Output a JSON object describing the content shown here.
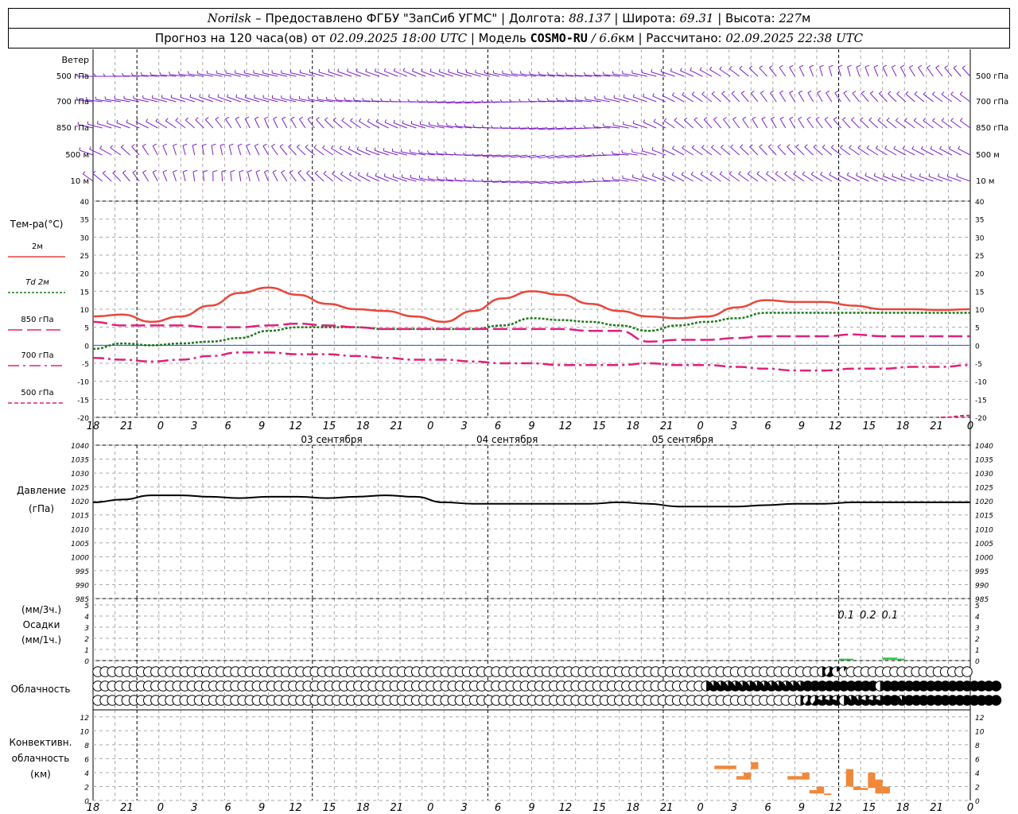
{
  "header": {
    "line1": {
      "station": "Norilsk",
      "dash": " – ",
      "provider": "Предоставлено ФГБУ \"ЗапСиб УГМС\"",
      "sep": " | ",
      "lon_label": "Долгота: ",
      "lon": "88.137",
      "lat_label": "Широта: ",
      "lat": "69.31",
      "alt_label": "Высота: ",
      "alt": "227",
      "alt_unit": "м"
    },
    "line2": {
      "prefix": "Прогноз на 120 часа(ов) от ",
      "start": "02.09.2025 18:00 UTC",
      "model_label": "  | Модель ",
      "model": "COSMO-RU",
      "model_res_sep": " / ",
      "model_res": "6.6",
      "model_res_unit": "км",
      "calc_label": " | Рассчитано: ",
      "calc": "02.09.2025 22:38 UTC"
    }
  },
  "labels": {
    "wind_title": "Ветер",
    "wind_levels": [
      "500 гПа",
      "700 гПа",
      "850 гПа",
      "500 м",
      "10  м"
    ],
    "temp_title": "Тем-ра(°C)",
    "temp_legend": [
      "2м",
      "Td  2м",
      "850 гПа",
      "700 гПа",
      "500 гПа"
    ],
    "pressure_title": "Давление",
    "pressure_unit": "(гПа)",
    "precip_unit_top": "(мм/3ч.)",
    "precip_title": "Осадки",
    "precip_unit_bottom": "(мм/1ч.)",
    "cloud_title": "Облачность",
    "conv_title": [
      "Конвективн.",
      "облачность",
      "(км)"
    ]
  },
  "colors": {
    "t2m": "#e8463c",
    "td2m": "#1a7a1a",
    "t850": "#e0207a",
    "t700": "#e0207a",
    "t500": "#e0207a",
    "wind": "#7b22c8",
    "pressure": "#000000",
    "precip": "#2ecc40",
    "conv": "#f0883a",
    "grid": "#aaaaaa"
  },
  "chart_data": [
    {
      "type": "line",
      "panel": "temperature",
      "x_hours": [
        0,
        3,
        6,
        9,
        12,
        15,
        18,
        21,
        24,
        27,
        30,
        33,
        36,
        39,
        42,
        45,
        48,
        51,
        54,
        57,
        60,
        63,
        66,
        69,
        72,
        75,
        78,
        81,
        84,
        87,
        90,
        93,
        96,
        99,
        102,
        105,
        108,
        111,
        114,
        117,
        120
      ],
      "x_tick_labels": [
        "18",
        "21",
        "0",
        "3",
        "6",
        "9",
        "12",
        "15",
        "18",
        "21",
        "0",
        "3",
        "6",
        "9",
        "12",
        "15",
        "18",
        "21",
        "0",
        "3",
        "6",
        "9",
        "12",
        "15",
        "18",
        "21",
        "0"
      ],
      "date_labels": [
        "03 сентября",
        "04 сентября",
        "05 сентября"
      ],
      "ylim": [
        -20,
        40
      ],
      "yticks": [
        -20,
        -15,
        -10,
        -5,
        0,
        5,
        10,
        15,
        20,
        25,
        30,
        35,
        40
      ],
      "series": [
        {
          "name": "2м",
          "style": "solid",
          "values": [
            8,
            8.5,
            6.5,
            8,
            11,
            14.5,
            16,
            14,
            11.5,
            10,
            9.5,
            8,
            6.5,
            9.5,
            13,
            15,
            14,
            11.5,
            9.5,
            8,
            7.5,
            8,
            10.5,
            12.5,
            12,
            12,
            11,
            10,
            10,
            9.8,
            10
          ]
        },
        {
          "name": "Td  2м",
          "style": "dotted",
          "values": [
            -1,
            0.5,
            0,
            0.5,
            1,
            2,
            4,
            5,
            5,
            5,
            4.5,
            4.5,
            4.5,
            4.5,
            5.5,
            7.5,
            7,
            6.5,
            5.5,
            4,
            5.5,
            6.5,
            7.5,
            9,
            9,
            9,
            9,
            9,
            9,
            9,
            9
          ]
        },
        {
          "name": "850 гПа",
          "style": "longdash",
          "values": [
            6.5,
            5.5,
            5.5,
            5.5,
            5,
            5,
            5.5,
            6,
            5.5,
            5,
            4.5,
            4.5,
            4.5,
            4.5,
            4.5,
            4.5,
            4.5,
            4,
            4,
            1,
            1.5,
            1.5,
            2,
            2.5,
            2.5,
            2.5,
            3,
            2.5,
            2.5,
            2.5,
            2.5
          ]
        },
        {
          "name": "700 гПа",
          "style": "dashdot",
          "values": [
            -3.5,
            -4,
            -4.5,
            -4,
            -3,
            -2,
            -2,
            -2.5,
            -2.5,
            -3,
            -3.5,
            -4,
            -4,
            -4.5,
            -5,
            -5,
            -5.5,
            -5.5,
            -5.5,
            -5,
            -5.5,
            -5.5,
            -6,
            -6.5,
            -7,
            -7,
            -6.5,
            -6.5,
            -6,
            -6,
            -5.5
          ]
        },
        {
          "name": "500 гПа",
          "style": "shortdash",
          "values": [
            -20,
            -20,
            -20,
            -20,
            -20,
            -20,
            -20,
            -20,
            -20,
            -20,
            -20,
            -20,
            -20,
            -20,
            -20,
            -20,
            -20,
            -20,
            -20,
            -20,
            -20,
            -20,
            -20,
            -20,
            -20,
            -20,
            -20,
            -20,
            -20,
            -20,
            -19.5
          ]
        }
      ]
    },
    {
      "type": "line",
      "panel": "pressure",
      "ylim": [
        985,
        1040
      ],
      "yticks": [
        985,
        990,
        995,
        1000,
        1005,
        1010,
        1015,
        1020,
        1025,
        1030,
        1035,
        1040
      ],
      "series": [
        {
          "name": "",
          "values": [
            1019.5,
            1020.5,
            1022,
            1022,
            1021.5,
            1021,
            1021.5,
            1021.5,
            1021,
            1021.5,
            1022,
            1021.5,
            1019.5,
            1019,
            1019,
            1019,
            1019,
            1019,
            1019.5,
            1019,
            1018,
            1018,
            1018,
            1018.5,
            1019,
            1019,
            1019.5,
            1019.5,
            1019.5,
            1019.5,
            1019.5
          ]
        }
      ]
    },
    {
      "type": "bar",
      "panel": "precipitation",
      "ylim": [
        0,
        5
      ],
      "yticks": [
        0,
        1,
        2,
        3,
        4,
        5
      ],
      "annotations": [
        {
          "x_hour": 103,
          "text": "0.1"
        },
        {
          "x_hour": 106,
          "text": "0.2"
        },
        {
          "x_hour": 109,
          "text": "0.1"
        }
      ],
      "bars": [
        {
          "x_hour": 102,
          "dx": 2,
          "value": 0.1
        },
        {
          "x_hour": 108,
          "dx": 1,
          "value": 0.2
        },
        {
          "x_hour": 109,
          "dx": 1,
          "value": 0.2
        },
        {
          "x_hour": 110,
          "dx": 1,
          "value": 0.1
        }
      ]
    },
    {
      "type": "table",
      "panel": "cloudiness",
      "rows": [
        "upper",
        "middle",
        "low"
      ],
      "fractions": [
        [
          0,
          0,
          0,
          0,
          0,
          0,
          0,
          0,
          0,
          0,
          0,
          0,
          0,
          0,
          0,
          0,
          0,
          0,
          0,
          0,
          0,
          0,
          0,
          0,
          0,
          0,
          0,
          0,
          0,
          0,
          0,
          0,
          0,
          0,
          0,
          0,
          0,
          0,
          0,
          0,
          0,
          0,
          0,
          0,
          0,
          0,
          0,
          0,
          0,
          0,
          0,
          0,
          0,
          0,
          0,
          0,
          0,
          0,
          0,
          0,
          0,
          0,
          0,
          0,
          0,
          0,
          0,
          0,
          0,
          0,
          0,
          0,
          0,
          0,
          0,
          0,
          0,
          0,
          0,
          0,
          0,
          0,
          0,
          0,
          0,
          0,
          0,
          0,
          0,
          0,
          0,
          0,
          0,
          0,
          0,
          0,
          0,
          0,
          0,
          0,
          0.5,
          0.6,
          0.2,
          0.1,
          0,
          0,
          0,
          0,
          0,
          0,
          0,
          0,
          0,
          0,
          0,
          0,
          0,
          0,
          0,
          0,
          0
        ],
        [
          0,
          0,
          0,
          0,
          0,
          0,
          0,
          0,
          0,
          0,
          0,
          0,
          0,
          0,
          0,
          0,
          0,
          0,
          0,
          0,
          0,
          0,
          0,
          0,
          0,
          0,
          0,
          0,
          0,
          0,
          0,
          0,
          0,
          0,
          0,
          0,
          0,
          0,
          0,
          0,
          0,
          0,
          0,
          0,
          0,
          0,
          0,
          0,
          0,
          0,
          0,
          0,
          0,
          0,
          0,
          0,
          0,
          0,
          0,
          0,
          0,
          0,
          0,
          0,
          0,
          0,
          0,
          0,
          0,
          0,
          0,
          0,
          0,
          0,
          0,
          0,
          0,
          0,
          0,
          0,
          0,
          0,
          0,
          0,
          0.5,
          0.9,
          0.9,
          0.9,
          0.9,
          0.9,
          0.9,
          0.9,
          0.9,
          0.9,
          0.9,
          0.9,
          0.9,
          0.9,
          1,
          1,
          1,
          1,
          1,
          1,
          1,
          1,
          1,
          1,
          0.5,
          1,
          1,
          1,
          1,
          1,
          1,
          1,
          1,
          1,
          1,
          1,
          1,
          1,
          1,
          1,
          1
        ],
        [
          0,
          0,
          0,
          0,
          0,
          0,
          0,
          0,
          0,
          0,
          0,
          0,
          0,
          0,
          0,
          0,
          0,
          0,
          0,
          0,
          0,
          0,
          0,
          0,
          0,
          0,
          0,
          0,
          0,
          0,
          0,
          0,
          0,
          0,
          0,
          0,
          0,
          0,
          0,
          0,
          0,
          0,
          0,
          0,
          0,
          0,
          0,
          0,
          0,
          0,
          0,
          0,
          0,
          0,
          0,
          0,
          0,
          0,
          0,
          0,
          0,
          0,
          0,
          0,
          0,
          0,
          0,
          0,
          0,
          0,
          0,
          0,
          0,
          0,
          0,
          0,
          0,
          0,
          0,
          0,
          0,
          0,
          0,
          0,
          0,
          0,
          0,
          0,
          0,
          0,
          0,
          0,
          0,
          0,
          0,
          0,
          0,
          0.5,
          0.6,
          0.6,
          0.8,
          0.8,
          0.8,
          0.5,
          0.9,
          0.9,
          0.8,
          0.8,
          0.8,
          1,
          1,
          0.9,
          1,
          1,
          1,
          1,
          1,
          1,
          1,
          1,
          1,
          1,
          1,
          1,
          1
        ]
      ]
    },
    {
      "type": "bar",
      "panel": "convective_cloud",
      "ylim": [
        0,
        13
      ],
      "yticks": [
        0,
        2,
        4,
        6,
        8,
        10,
        12
      ],
      "bars": [
        {
          "x_hour": 85,
          "dx": 3,
          "bottom": 4.5,
          "top": 5
        },
        {
          "x_hour": 88,
          "dx": 1,
          "bottom": 3,
          "top": 3.5
        },
        {
          "x_hour": 89,
          "dx": 1,
          "bottom": 3,
          "top": 4
        },
        {
          "x_hour": 90,
          "dx": 1,
          "bottom": 4.5,
          "top": 5.5
        },
        {
          "x_hour": 95,
          "dx": 2,
          "bottom": 3,
          "top": 3.5
        },
        {
          "x_hour": 97,
          "dx": 1,
          "bottom": 3,
          "top": 4
        },
        {
          "x_hour": 98,
          "dx": 1,
          "bottom": 1,
          "top": 1.5
        },
        {
          "x_hour": 99,
          "dx": 1,
          "bottom": 1,
          "top": 2
        },
        {
          "x_hour": 100,
          "dx": 1,
          "bottom": 0.8,
          "top": 1
        },
        {
          "x_hour": 103,
          "dx": 1,
          "bottom": 2,
          "top": 4.5
        },
        {
          "x_hour": 104,
          "dx": 1,
          "bottom": 1.5,
          "top": 2
        },
        {
          "x_hour": 105,
          "dx": 1,
          "bottom": 1.5,
          "top": 1.8
        },
        {
          "x_hour": 106,
          "dx": 1,
          "bottom": 1.8,
          "top": 4
        },
        {
          "x_hour": 107,
          "dx": 1,
          "bottom": 1,
          "top": 3
        },
        {
          "x_hour": 108,
          "dx": 1,
          "bottom": 1,
          "top": 2
        }
      ]
    },
    {
      "type": "scatter",
      "panel": "wind",
      "levels": [
        "500 гПа",
        "700 гПа",
        "850 гПа",
        "500 м",
        "10  м"
      ],
      "directions_deg_by_level": [
        [
          270,
          270,
          275,
          280,
          285,
          290,
          290,
          290,
          295,
          300,
          300,
          305,
          300,
          295,
          290,
          285,
          280,
          275,
          280,
          290,
          300,
          310,
          320,
          330,
          340,
          350,
          350,
          345,
          340,
          335,
          330
        ],
        [
          280,
          285,
          290,
          295,
          300,
          300,
          295,
          290,
          285,
          280,
          275,
          270,
          265,
          260,
          265,
          270,
          275,
          280,
          290,
          300,
          310,
          320,
          330,
          335,
          340,
          340,
          335,
          330,
          325,
          320,
          320
        ],
        [
          290,
          300,
          310,
          320,
          330,
          340,
          345,
          340,
          330,
          320,
          310,
          300,
          290,
          280,
          270,
          265,
          260,
          265,
          280,
          300,
          320,
          330,
          335,
          340,
          340,
          335,
          330,
          325,
          320,
          320,
          320
        ],
        [
          300,
          320,
          340,
          350,
          355,
          350,
          340,
          330,
          320,
          310,
          300,
          290,
          280,
          270,
          260,
          255,
          250,
          255,
          270,
          290,
          310,
          320,
          325,
          330,
          330,
          325,
          320,
          315,
          310,
          310,
          310
        ],
        [
          320,
          330,
          340,
          350,
          0,
          355,
          345,
          335,
          325,
          315,
          305,
          295,
          285,
          275,
          265,
          260,
          255,
          260,
          275,
          295,
          310,
          315,
          320,
          320,
          320,
          315,
          310,
          305,
          300,
          300,
          300
        ]
      ]
    }
  ]
}
